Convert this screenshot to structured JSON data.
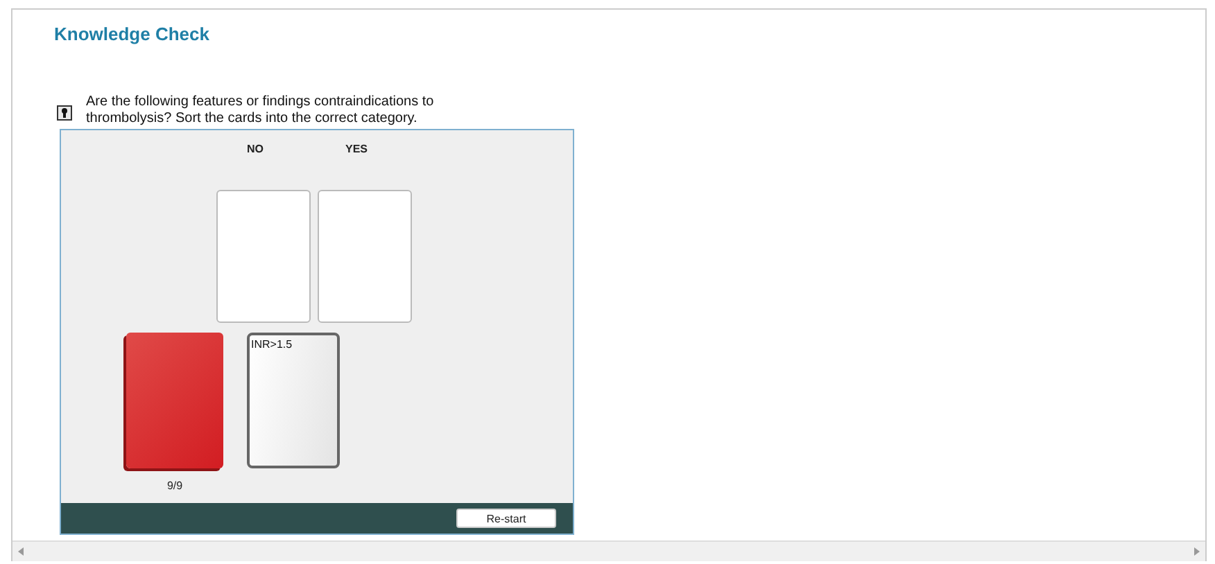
{
  "title": "Knowledge Check",
  "question": {
    "text": "Are the following features or findings contraindications to thrombolysis? Sort the cards into the correct category."
  },
  "categories": [
    {
      "label": "NO"
    },
    {
      "label": "YES"
    }
  ],
  "deck": {
    "count": "9/9"
  },
  "current_card": {
    "text": "INR>1.5"
  },
  "buttons": [
    {
      "label": "Re-start"
    }
  ]
}
